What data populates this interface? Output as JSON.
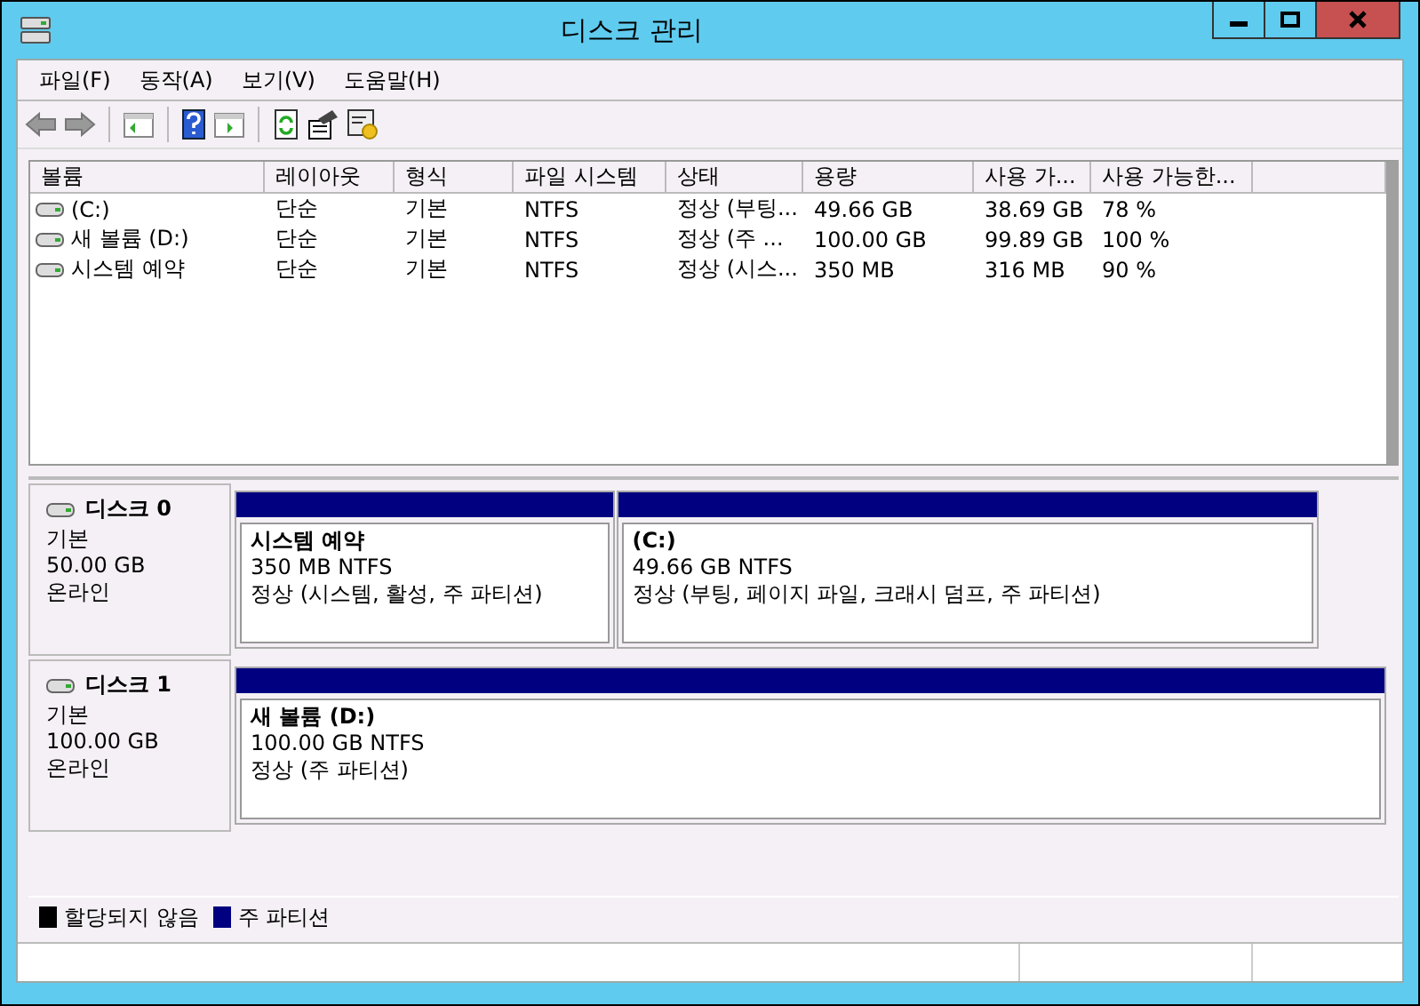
{
  "window": {
    "title": "디스크 관리"
  },
  "menu": [
    "파일(F)",
    "동작(A)",
    "보기(V)",
    "도움말(H)"
  ],
  "table": {
    "columns": [
      "볼륨",
      "레이아웃",
      "형식",
      "파일 시스템",
      "상태",
      "용량",
      "사용 가...",
      "사용 가능한..."
    ],
    "rows": [
      [
        "(C:)",
        "단순",
        "기본",
        "NTFS",
        "정상 (부팅...",
        "49.66 GB",
        "38.69 GB",
        "78 %"
      ],
      [
        "새 볼륨 (D:)",
        "단순",
        "기본",
        "NTFS",
        "정상 (주 ...",
        "100.00 GB",
        "99.89 GB",
        "100 %"
      ],
      [
        "시스템 예약",
        "단순",
        "기본",
        "NTFS",
        "정상 (시스...",
        "350 MB",
        "316 MB",
        "90 %"
      ]
    ]
  },
  "disks": [
    {
      "name": "디스크 0",
      "type": "기본",
      "size": "50.00 GB",
      "status": "온라인",
      "partitions": [
        {
          "name": "시스템 예약",
          "size": "350 MB NTFS",
          "status": "정상 (시스템, 활성, 주 파티션)",
          "kind": "primary"
        },
        {
          "name": "(C:)",
          "size": "49.66 GB NTFS",
          "status": "정상 (부팅, 페이지 파일, 크래시 덤프, 주 파티션)",
          "kind": "primary"
        }
      ]
    },
    {
      "name": "디스크 1",
      "type": "기본",
      "size": "100.00 GB",
      "status": "온라인",
      "partitions": [
        {
          "name": "새 볼륨  (D:)",
          "size": "100.00 GB NTFS",
          "status": "정상 (주 파티션)",
          "kind": "primary"
        }
      ]
    }
  ],
  "legend": [
    {
      "label": "할당되지 않음",
      "kind": "unallocated",
      "color": "#000000"
    },
    {
      "label": "주 파티션",
      "kind": "primary",
      "color": "#000080"
    }
  ]
}
